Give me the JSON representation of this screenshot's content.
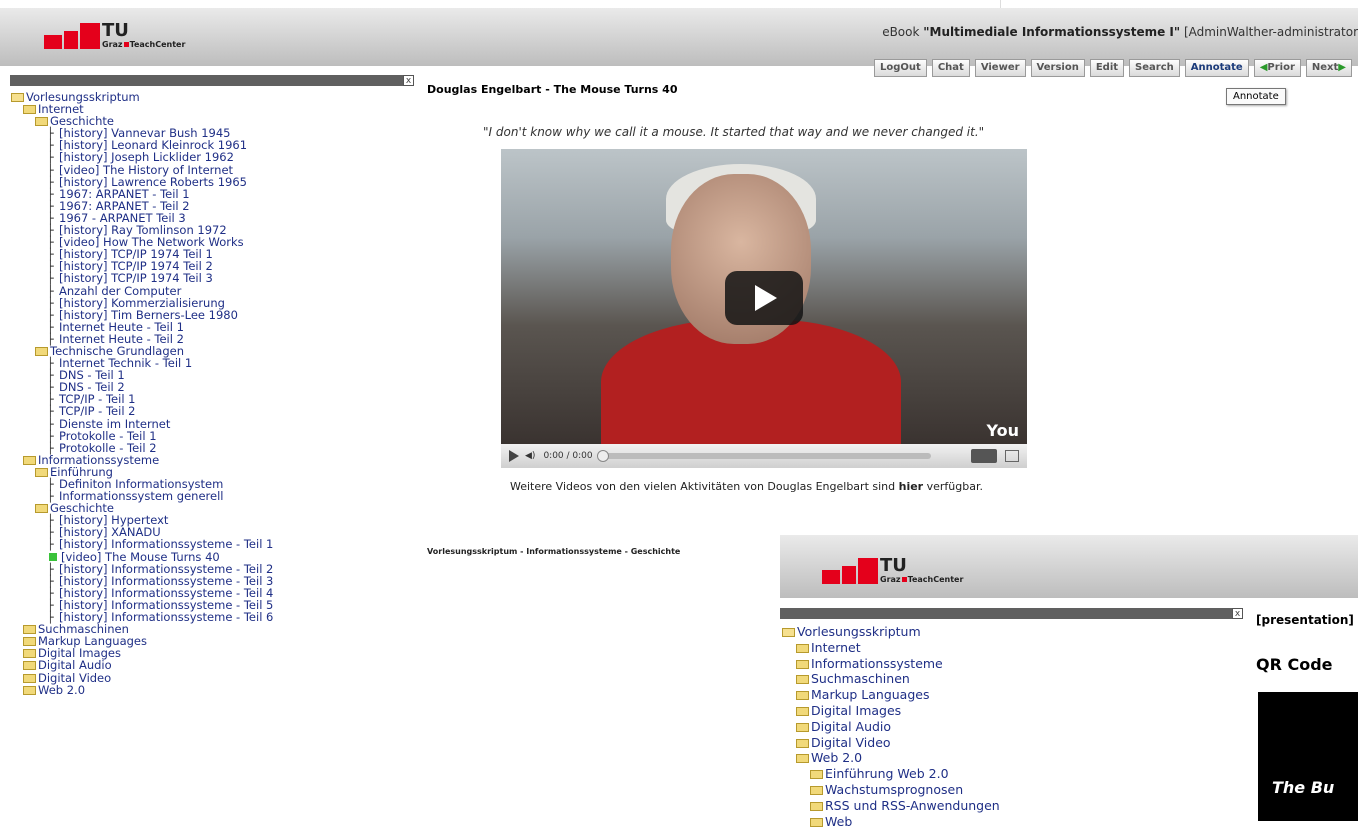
{
  "header": {
    "logo": {
      "tu": "TU",
      "graz": "Graz",
      "teachcenter": "TeachCenter"
    },
    "ebook_prefix": "eBook ",
    "ebook_title": "\"Multimediale Informationssysteme I\"",
    "ebook_suffix": " [AdminWalther-administrator"
  },
  "toolbar": {
    "logout": "LogOut",
    "chat": "Chat",
    "viewer": "Viewer",
    "version": "Version",
    "edit": "Edit",
    "search": "Search",
    "annotate": "Annotate",
    "prior": "Prior",
    "next": "Next"
  },
  "annotate_popup": "Annotate",
  "sidebar_close": "x",
  "tree": [
    {
      "level": 0,
      "type": "folder",
      "label": "Vorlesungsskriptum"
    },
    {
      "level": 1,
      "type": "folder",
      "label": "Internet"
    },
    {
      "level": 2,
      "type": "folder",
      "label": "Geschichte"
    },
    {
      "level": 3,
      "type": "page",
      "label": "[history] Vannevar Bush 1945"
    },
    {
      "level": 3,
      "type": "page",
      "label": "[history] Leonard Kleinrock 1961"
    },
    {
      "level": 3,
      "type": "page",
      "label": "[history] Joseph Licklider 1962"
    },
    {
      "level": 3,
      "type": "page",
      "label": "[video] The History of Internet"
    },
    {
      "level": 3,
      "type": "page",
      "label": "[history] Lawrence Roberts 1965"
    },
    {
      "level": 3,
      "type": "page",
      "label": "1967: ARPANET - Teil 1"
    },
    {
      "level": 3,
      "type": "page",
      "label": "1967: ARPANET - Teil 2"
    },
    {
      "level": 3,
      "type": "page",
      "label": "1967 - ARPANET Teil 3"
    },
    {
      "level": 3,
      "type": "page",
      "label": "[history] Ray Tomlinson 1972"
    },
    {
      "level": 3,
      "type": "page",
      "label": "[video] How The Network Works"
    },
    {
      "level": 3,
      "type": "page",
      "label": "[history] TCP/IP 1974 Teil 1"
    },
    {
      "level": 3,
      "type": "page",
      "label": "[history] TCP/IP 1974 Teil 2"
    },
    {
      "level": 3,
      "type": "page",
      "label": "[history] TCP/IP 1974 Teil 3"
    },
    {
      "level": 3,
      "type": "page",
      "label": "Anzahl der Computer"
    },
    {
      "level": 3,
      "type": "page",
      "label": "[history] Kommerzialisierung"
    },
    {
      "level": 3,
      "type": "page",
      "label": "[history] Tim Berners-Lee 1980"
    },
    {
      "level": 3,
      "type": "page",
      "label": "Internet Heute - Teil 1"
    },
    {
      "level": 3,
      "type": "page",
      "label": "Internet Heute - Teil 2"
    },
    {
      "level": 2,
      "type": "folder",
      "label": "Technische Grundlagen"
    },
    {
      "level": 3,
      "type": "page",
      "label": "Internet Technik - Teil 1"
    },
    {
      "level": 3,
      "type": "page",
      "label": "DNS - Teil 1"
    },
    {
      "level": 3,
      "type": "page",
      "label": "DNS - Teil 2"
    },
    {
      "level": 3,
      "type": "page",
      "label": "TCP/IP - Teil 1"
    },
    {
      "level": 3,
      "type": "page",
      "label": "TCP/IP - Teil 2"
    },
    {
      "level": 3,
      "type": "page",
      "label": "Dienste im Internet"
    },
    {
      "level": 3,
      "type": "page",
      "label": "Protokolle - Teil 1"
    },
    {
      "level": 3,
      "type": "page",
      "label": "Protokolle - Teil 2"
    },
    {
      "level": 1,
      "type": "folder",
      "label": "Informationssysteme"
    },
    {
      "level": 2,
      "type": "folder",
      "label": "Einführung"
    },
    {
      "level": 3,
      "type": "page",
      "label": "Definiton Informationsystem"
    },
    {
      "level": 3,
      "type": "page",
      "label": "Informationssystem generell"
    },
    {
      "level": 2,
      "type": "folder",
      "label": "Geschichte"
    },
    {
      "level": 3,
      "type": "page",
      "label": "[history] Hypertext"
    },
    {
      "level": 3,
      "type": "page",
      "label": "[history] XANADU"
    },
    {
      "level": 3,
      "type": "page",
      "label": "[history] Informationssysteme - Teil 1"
    },
    {
      "level": 3,
      "type": "current",
      "label": "[video] The Mouse Turns 40"
    },
    {
      "level": 3,
      "type": "page",
      "label": "[history] Informationssysteme - Teil 2"
    },
    {
      "level": 3,
      "type": "page",
      "label": "[history] Informationssysteme - Teil 3"
    },
    {
      "level": 3,
      "type": "page",
      "label": "[history] Informationssysteme - Teil 4"
    },
    {
      "level": 3,
      "type": "page",
      "label": "[history] Informationssysteme - Teil 5"
    },
    {
      "level": 3,
      "type": "page",
      "label": "[history] Informationssysteme - Teil 6"
    },
    {
      "level": 1,
      "type": "folder",
      "label": "Suchmaschinen"
    },
    {
      "level": 1,
      "type": "folder",
      "label": "Markup Languages"
    },
    {
      "level": 1,
      "type": "folder",
      "label": "Digital Images"
    },
    {
      "level": 1,
      "type": "folder",
      "label": "Digital Audio"
    },
    {
      "level": 1,
      "type": "folder",
      "label": "Digital Video"
    },
    {
      "level": 1,
      "type": "folder",
      "label": "Web 2.0"
    }
  ],
  "content": {
    "title": "Douglas Engelbart - The Mouse Turns 40",
    "quote": "\"I don't know why we call it a mouse. It started that way and we never changed it.\"",
    "video_time": "0:00 / 0:00",
    "youtube_logo": "You",
    "more_prefix": "Weitere Videos von den vielen Aktivitäten von Douglas Engelbart sind ",
    "more_link": "hier",
    "more_suffix": " verfügbar.",
    "breadcrumb": "Vorlesungsskriptum - Informationssysteme - Geschichte"
  },
  "window2": {
    "tree": [
      {
        "level": 0,
        "label": "Vorlesungsskriptum"
      },
      {
        "level": 1,
        "label": "Internet"
      },
      {
        "level": 1,
        "label": "Informationssysteme"
      },
      {
        "level": 1,
        "label": "Suchmaschinen"
      },
      {
        "level": 1,
        "label": "Markup Languages"
      },
      {
        "level": 1,
        "label": "Digital Images"
      },
      {
        "level": 1,
        "label": "Digital Audio"
      },
      {
        "level": 1,
        "label": "Digital Video"
      },
      {
        "level": 1,
        "label": "Web 2.0"
      },
      {
        "level": 2,
        "label": "Einführung Web 2.0"
      },
      {
        "level": 2,
        "label": "Wachstumsprognosen"
      },
      {
        "level": 2,
        "label": "RSS und RSS-Anwendungen"
      },
      {
        "level": 2,
        "label": "Web"
      }
    ],
    "presentation": "[presentation]",
    "qr_heading": "QR Code",
    "qr_image_text": "The Bu"
  }
}
